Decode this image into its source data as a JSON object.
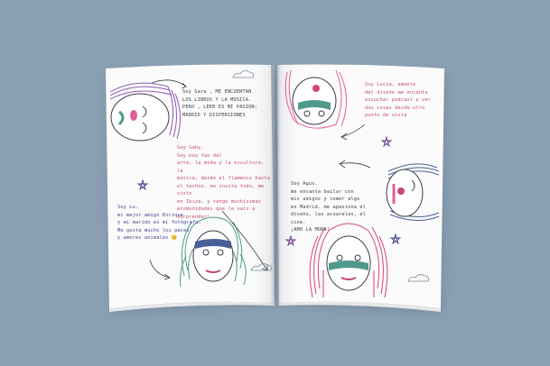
{
  "colors": {
    "background": "#8a9fb2",
    "page": "#fbfbfb",
    "ink_dark": "#3a3d4a",
    "ink_red": "#c44a6a",
    "ink_blue": "#3b3f8c",
    "hair_purple": "#8c5bb8",
    "hair_pink": "#e0609a",
    "hair_green": "#4f9a8a",
    "hair_blue": "#4a5f9a",
    "hair_red": "#d8447a"
  },
  "left_page": {
    "note_top": "Soy Sara , ME ENCUENTAN\nLOS LIBROS Y LA MÚSICA.\nPERO , LEER ES MI PASIÓN:\nMADRID Y DISPERSIONES",
    "note_middle": "Soy Gaby.\nSoy muy fan del\narte, la moda y la escultura. la\nmúsica, desde el flamenco hasta\nel techno. me invita todo, me visto\nen Ibiza, y tengo muchísimas\necomunidades que le vais a\nsorprender!",
    "note_bottom": "Soy Lu.\nmi mejor amigo Enrique\ny mi marido es mi fotógrafo.\nMe gusta mucho los peces\ny amores animales 😊"
  },
  "right_page": {
    "note_top": "Soy Lucía, amante\ndel diseño me encanta\nescuchar podcast y ver\ndos cosas desde otro\npunto de vista",
    "note_middle": "Soy Agus.\nme encanta bailar con\nmis amigos y comer algo\nen Madrid. me apasiona el\ndiseño, las acuarelas, el cine.\n¡AMO LA MODA!"
  }
}
